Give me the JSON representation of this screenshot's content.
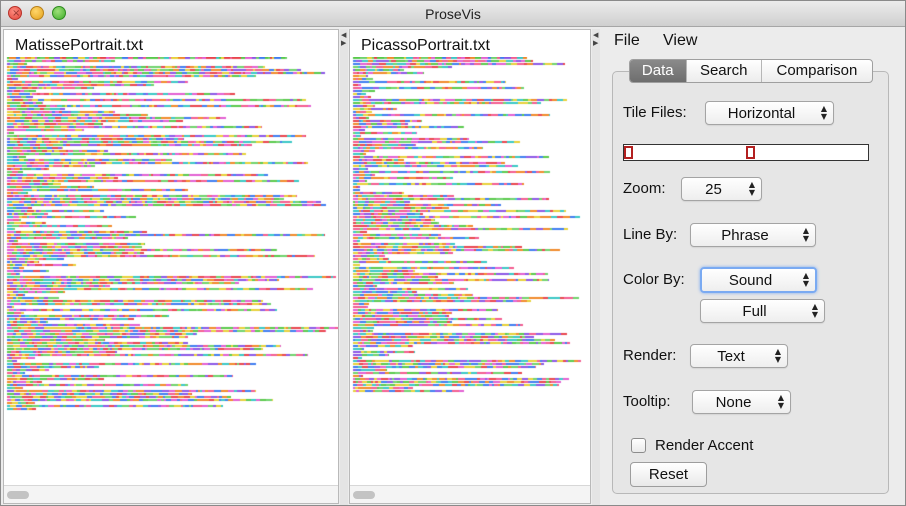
{
  "window": {
    "title": "ProseVis"
  },
  "panels": [
    {
      "file_name": "MatissePortrait.txt"
    },
    {
      "file_name": "PicassoPortrait.txt"
    }
  ],
  "menu": {
    "file": "File",
    "view": "View"
  },
  "tabs": [
    {
      "label": "Data",
      "selected": true
    },
    {
      "label": "Search",
      "selected": false
    },
    {
      "label": "Comparison",
      "selected": false
    }
  ],
  "controls": {
    "tile_files": {
      "label": "Tile Files:",
      "value": "Horizontal"
    },
    "zoom": {
      "label": "Zoom:",
      "value": "25"
    },
    "line_by": {
      "label": "Line By:",
      "value": "Phrase"
    },
    "color_by": {
      "label": "Color By:",
      "value": "Sound",
      "sub_value": "Full"
    },
    "render": {
      "label": "Render:",
      "value": "Text"
    },
    "tooltip": {
      "label": "Tooltip:",
      "value": "None"
    },
    "render_accent": {
      "label": "Render Accent",
      "checked": false
    },
    "reset": {
      "label": "Reset"
    }
  },
  "colors": {
    "viz_palette": [
      "#e8454d",
      "#f08a2a",
      "#e7d13a",
      "#59c94b",
      "#3ac7c5",
      "#3f7df0",
      "#8b57e6",
      "#e25fd2",
      "#6fd36b",
      "#f25c8f"
    ],
    "selected_tab": "#777777",
    "focus_ring": "#7aaaf2",
    "range_handle": "#b32020"
  },
  "icons": {
    "window_close": "close-icon",
    "window_minimize": "minimize-icon",
    "window_maximize": "maximize-icon",
    "select_arrows": "updown-arrows-icon"
  }
}
